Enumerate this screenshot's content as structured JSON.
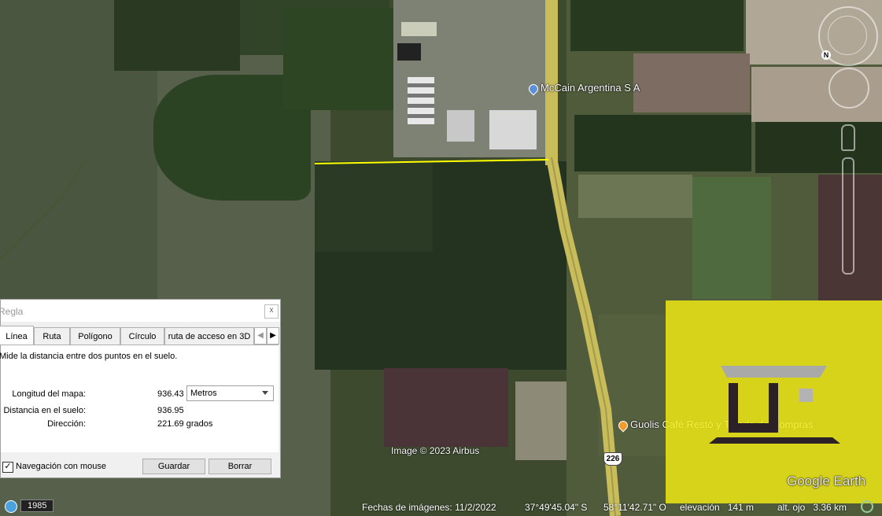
{
  "map": {
    "places": {
      "mccain": "McCain Argentina S A",
      "guolis": "Guolis Café Restó y Tienda de Compras"
    },
    "route_shield": "226",
    "image_credit": "Image © 2023 Airbus",
    "watermark": "Google Earth",
    "measure_line_color": "#ffff00"
  },
  "dialog": {
    "title": "Regla",
    "close_label": "x",
    "tabs": [
      "Línea",
      "Ruta",
      "Polígono",
      "Círculo",
      "ruta de acceso en 3D"
    ],
    "active_tab": "Línea",
    "description": "Mide la distancia entre dos puntos en el suelo.",
    "rows": {
      "map_length_label": "Longitud del mapa:",
      "map_length_value": "936.43",
      "ground_distance_label": "Distancia en el suelo:",
      "ground_distance_value": "936.95",
      "direction_label": "Dirección:",
      "direction_value": "221.69 grados"
    },
    "unit_select": "Metros",
    "mouse_nav_label": "Navegación con mouse",
    "mouse_nav_checked": "✓",
    "save_label": "Guardar",
    "clear_label": "Borrar"
  },
  "statusbar": {
    "year": "1985",
    "imagery_date": "Fechas de imágenes: 11/2/2022",
    "lat": "37°49'45.04\" S",
    "lon": "58°11'42.71\" O",
    "elevation": "elevación   141 m",
    "eye_alt": "alt. ojo   3.36 km"
  }
}
